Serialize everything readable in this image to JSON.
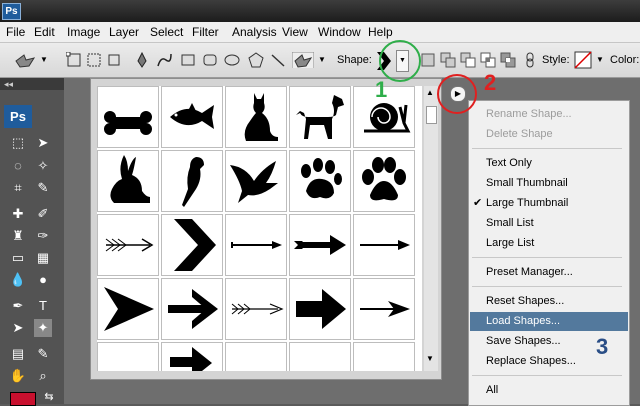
{
  "menubar": {
    "items": [
      "File",
      "Edit",
      "Image",
      "Layer",
      "Select",
      "Filter",
      "Analysis",
      "View",
      "Window",
      "Help"
    ]
  },
  "optbar": {
    "shape_label": "Shape:",
    "style_label": "Style:",
    "color_label": "Color:"
  },
  "menu": {
    "items": [
      {
        "label": "Rename Shape...",
        "state": "disabled"
      },
      {
        "label": "Delete Shape",
        "state": "disabled"
      },
      {
        "label": "Text Only",
        "state": "normal"
      },
      {
        "label": "Small Thumbnail",
        "state": "normal"
      },
      {
        "label": "Large Thumbnail",
        "state": "checked"
      },
      {
        "label": "Small List",
        "state": "normal"
      },
      {
        "label": "Large List",
        "state": "normal"
      },
      {
        "label": "Preset Manager...",
        "state": "normal"
      },
      {
        "label": "Reset Shapes...",
        "state": "normal"
      },
      {
        "label": "Load Shapes...",
        "state": "highlighted"
      },
      {
        "label": "Save Shapes...",
        "state": "normal"
      },
      {
        "label": "Replace Shapes...",
        "state": "normal"
      },
      {
        "label": "All",
        "state": "normal"
      }
    ]
  },
  "annotations": {
    "n1": "1",
    "n2": "2",
    "n3": "3"
  },
  "shapes": [
    "bone",
    "fish",
    "cat",
    "dog",
    "snail",
    "rabbit",
    "bird",
    "dove",
    "paw-print",
    "paw",
    "arrow-feather",
    "chevron",
    "thin-arrow",
    "arrow-feathered-tail",
    "line-arrow",
    "triangle-arrow",
    "block-arrow",
    "feather-arrow",
    "fat-arrow",
    "spear-arrow"
  ]
}
